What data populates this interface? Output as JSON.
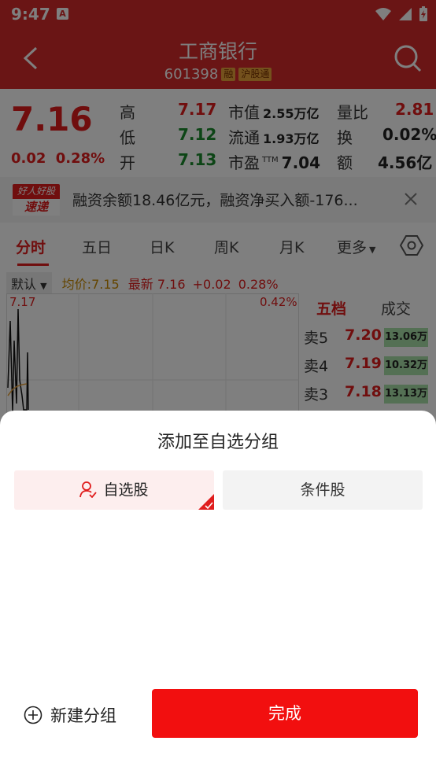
{
  "status_bar": {
    "time": "9:47",
    "a_label": "A"
  },
  "header": {
    "title": "工商银行",
    "code": "601398",
    "tags": [
      "融",
      "沪股通"
    ]
  },
  "quote": {
    "price": "7.16",
    "change": "0.02",
    "change_pct": "0.28%",
    "cells": [
      {
        "label": "高",
        "value": "7.17",
        "color": "red"
      },
      {
        "label": "低",
        "value": "7.12",
        "color": "green"
      },
      {
        "label": "开",
        "value": "7.13",
        "color": "green"
      }
    ],
    "mid": [
      {
        "label": "市值",
        "value": "2.55万亿"
      },
      {
        "label": "流通",
        "value": "1.93万亿"
      },
      {
        "label": "市盈",
        "sup": "TTM",
        "value": "7.04"
      }
    ],
    "right": [
      {
        "label": "量比",
        "value": "2.81",
        "color": "red"
      },
      {
        "label": "换",
        "value": "0.02%"
      },
      {
        "label": "额",
        "value": "4.56亿"
      }
    ]
  },
  "news": {
    "logo_top": "好人好股",
    "logo_bottom": "速递",
    "text": "融资余额18.46亿元，融资净买入额-176..."
  },
  "tabs": [
    "分时",
    "五日",
    "日K",
    "周K",
    "月K",
    "更多"
  ],
  "chart": {
    "default_label": "默认",
    "avg": "均价:7.15",
    "latest": "最新 7.16",
    "chg": "+0.02",
    "pct": "0.28%",
    "top_left": "7.17",
    "top_right": "0.42%"
  },
  "orderbook": {
    "tab_active": "五档",
    "tab_other": "成交",
    "rows": [
      {
        "label": "卖5",
        "price": "7.20",
        "vol": "13.06万"
      },
      {
        "label": "卖4",
        "price": "7.19",
        "vol": "10.32万"
      },
      {
        "label": "卖3",
        "price": "7.18",
        "vol": "13.13万"
      }
    ]
  },
  "sheet": {
    "title": "添加至自选分组",
    "group_selected": "自选股",
    "group_other": "条件股",
    "new_group": "新建分组",
    "done": "完成"
  },
  "colors": {
    "brand_red": "#d42a2a",
    "done_red": "#f20f0f",
    "price_red": "#e01d1d",
    "price_green": "#1a8a2c"
  }
}
